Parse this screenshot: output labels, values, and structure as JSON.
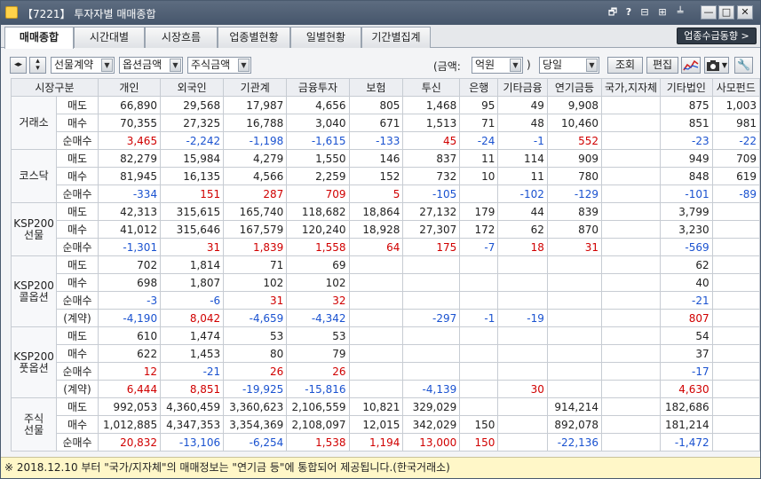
{
  "title": "【7221】 투자자별 매매종합",
  "titlebar_icons": {
    "i1": "🗗",
    "i2": "?",
    "i3": "⊟",
    "i4": "⊞",
    "i5": "╧"
  },
  "window_buttons": {
    "minimize": "—",
    "maximize": "□",
    "close": "✕"
  },
  "tabs": [
    "매매종합",
    "시간대별",
    "시장흐름",
    "업종별현황",
    "일별현황",
    "기간별집계"
  ],
  "jump_button": "업종수급동향 >",
  "toolbar": {
    "select_market": "선물계약",
    "select_option": "옵션금액",
    "select_stock": "주식금액",
    "unit_label_open": "(금액:",
    "unit_value": "억원",
    "unit_label_close": ")",
    "period_value": "당일",
    "query_button": "조회",
    "edit_button": "편집"
  },
  "columns": [
    "시장구분",
    "개인",
    "외국인",
    "기관계",
    "금융투자",
    "보험",
    "투신",
    "은행",
    "기타금융",
    "연기금등",
    "국가,지자체",
    "기타법인",
    "사모펀드"
  ],
  "sections": [
    {
      "market": "거래소",
      "rows": [
        {
          "label": "매도",
          "cells": [
            [
              "66,890",
              "k"
            ],
            [
              "29,568",
              "k"
            ],
            [
              "17,987",
              "k"
            ],
            [
              "4,656",
              "k"
            ],
            [
              "805",
              "k"
            ],
            [
              "1,468",
              "k"
            ],
            [
              "95",
              "k"
            ],
            [
              "49",
              "k"
            ],
            [
              "9,908",
              "k"
            ],
            [
              "",
              ""
            ],
            [
              "875",
              "k"
            ],
            [
              "1,003",
              "k"
            ]
          ]
        },
        {
          "label": "매수",
          "cells": [
            [
              "70,355",
              "k"
            ],
            [
              "27,325",
              "k"
            ],
            [
              "16,788",
              "k"
            ],
            [
              "3,040",
              "k"
            ],
            [
              "671",
              "k"
            ],
            [
              "1,513",
              "k"
            ],
            [
              "71",
              "k"
            ],
            [
              "48",
              "k"
            ],
            [
              "10,460",
              "k"
            ],
            [
              "",
              ""
            ],
            [
              "851",
              "k"
            ],
            [
              "981",
              "k"
            ]
          ]
        },
        {
          "label": "순매수",
          "cells": [
            [
              "3,465",
              "rb"
            ],
            [
              "-2,242",
              "bb"
            ],
            [
              "-1,198",
              "bb"
            ],
            [
              "-1,615",
              "b"
            ],
            [
              "-133",
              "b"
            ],
            [
              "45",
              "r"
            ],
            [
              "-24",
              "b"
            ],
            [
              "-1",
              "b"
            ],
            [
              "552",
              "r"
            ],
            [
              "",
              ""
            ],
            [
              "-23",
              "bb"
            ],
            [
              "-22",
              "b"
            ]
          ]
        }
      ]
    },
    {
      "market": "코스닥",
      "rows": [
        {
          "label": "매도",
          "cells": [
            [
              "82,279",
              "k"
            ],
            [
              "15,984",
              "k"
            ],
            [
              "4,279",
              "k"
            ],
            [
              "1,550",
              "k"
            ],
            [
              "146",
              "k"
            ],
            [
              "837",
              "k"
            ],
            [
              "11",
              "k"
            ],
            [
              "114",
              "k"
            ],
            [
              "909",
              "k"
            ],
            [
              "",
              ""
            ],
            [
              "949",
              "k"
            ],
            [
              "709",
              "k"
            ]
          ]
        },
        {
          "label": "매수",
          "cells": [
            [
              "81,945",
              "k"
            ],
            [
              "16,135",
              "k"
            ],
            [
              "4,566",
              "k"
            ],
            [
              "2,259",
              "k"
            ],
            [
              "152",
              "k"
            ],
            [
              "732",
              "k"
            ],
            [
              "10",
              "k"
            ],
            [
              "11",
              "k"
            ],
            [
              "780",
              "k"
            ],
            [
              "",
              ""
            ],
            [
              "848",
              "k"
            ],
            [
              "619",
              "k"
            ]
          ]
        },
        {
          "label": "순매수",
          "cells": [
            [
              "-334",
              "bb"
            ],
            [
              "151",
              "rb"
            ],
            [
              "287",
              "rb"
            ],
            [
              "709",
              "r"
            ],
            [
              "5",
              "r"
            ],
            [
              "-105",
              "b"
            ],
            [
              "",
              ""
            ],
            [
              "-102",
              "b"
            ],
            [
              "-129",
              "b"
            ],
            [
              "",
              ""
            ],
            [
              "-101",
              "bb"
            ],
            [
              "-89",
              "b"
            ]
          ]
        }
      ]
    },
    {
      "market": "KSP200\n선물",
      "rows": [
        {
          "label": "매도",
          "cells": [
            [
              "42,313",
              "k"
            ],
            [
              "315,615",
              "k"
            ],
            [
              "165,740",
              "k"
            ],
            [
              "118,682",
              "k"
            ],
            [
              "18,864",
              "k"
            ],
            [
              "27,132",
              "k"
            ],
            [
              "179",
              "k"
            ],
            [
              "44",
              "k"
            ],
            [
              "839",
              "k"
            ],
            [
              "",
              ""
            ],
            [
              "3,799",
              "k"
            ],
            [
              "",
              ""
            ]
          ]
        },
        {
          "label": "매수",
          "cells": [
            [
              "41,012",
              "k"
            ],
            [
              "315,646",
              "k"
            ],
            [
              "167,579",
              "k"
            ],
            [
              "120,240",
              "k"
            ],
            [
              "18,928",
              "k"
            ],
            [
              "27,307",
              "k"
            ],
            [
              "172",
              "k"
            ],
            [
              "62",
              "k"
            ],
            [
              "870",
              "k"
            ],
            [
              "",
              ""
            ],
            [
              "3,230",
              "k"
            ],
            [
              "",
              ""
            ]
          ]
        },
        {
          "label": "순매수",
          "cells": [
            [
              "-1,301",
              "bb"
            ],
            [
              "31",
              "rb"
            ],
            [
              "1,839",
              "rb"
            ],
            [
              "1,558",
              "r"
            ],
            [
              "64",
              "r"
            ],
            [
              "175",
              "r"
            ],
            [
              "-7",
              "b"
            ],
            [
              "18",
              "r"
            ],
            [
              "31",
              "r"
            ],
            [
              "",
              ""
            ],
            [
              "-569",
              "bb"
            ],
            [
              "",
              ""
            ]
          ]
        }
      ]
    },
    {
      "market": "KSP200\n콜옵션",
      "rows": [
        {
          "label": "매도",
          "cells": [
            [
              "702",
              "k"
            ],
            [
              "1,814",
              "k"
            ],
            [
              "71",
              "k"
            ],
            [
              "69",
              "k"
            ],
            [
              "",
              ""
            ],
            [
              "",
              ""
            ],
            [
              "",
              ""
            ],
            [
              "",
              ""
            ],
            [
              "",
              ""
            ],
            [
              "",
              ""
            ],
            [
              "62",
              "k"
            ],
            [
              "",
              ""
            ]
          ]
        },
        {
          "label": "매수",
          "cells": [
            [
              "698",
              "k"
            ],
            [
              "1,807",
              "k"
            ],
            [
              "102",
              "k"
            ],
            [
              "102",
              "k"
            ],
            [
              "",
              ""
            ],
            [
              "",
              ""
            ],
            [
              "",
              ""
            ],
            [
              "",
              ""
            ],
            [
              "",
              ""
            ],
            [
              "",
              ""
            ],
            [
              "40",
              "k"
            ],
            [
              "",
              ""
            ]
          ]
        },
        {
          "label": "순매수",
          "cells": [
            [
              "-3",
              "bb"
            ],
            [
              "-6",
              "bb"
            ],
            [
              "31",
              "rb"
            ],
            [
              "32",
              "r"
            ],
            [
              "",
              ""
            ],
            [
              "",
              ""
            ],
            [
              "",
              ""
            ],
            [
              "",
              ""
            ],
            [
              "",
              ""
            ],
            [
              "",
              ""
            ],
            [
              "-21",
              "bb"
            ],
            [
              "",
              ""
            ]
          ]
        },
        {
          "label": "(계약)",
          "cells": [
            [
              "-4,190",
              "b"
            ],
            [
              "8,042",
              "r"
            ],
            [
              "-4,659",
              "b"
            ],
            [
              "-4,342",
              "b"
            ],
            [
              "",
              ""
            ],
            [
              "-297",
              "b"
            ],
            [
              "-1",
              "b"
            ],
            [
              "-19",
              "b"
            ],
            [
              "",
              ""
            ],
            [
              "",
              ""
            ],
            [
              "807",
              "r"
            ],
            [
              "",
              ""
            ]
          ]
        }
      ]
    },
    {
      "market": "KSP200\n풋옵션",
      "rows": [
        {
          "label": "매도",
          "cells": [
            [
              "610",
              "k"
            ],
            [
              "1,474",
              "k"
            ],
            [
              "53",
              "k"
            ],
            [
              "53",
              "k"
            ],
            [
              "",
              ""
            ],
            [
              "",
              ""
            ],
            [
              "",
              ""
            ],
            [
              "",
              ""
            ],
            [
              "",
              ""
            ],
            [
              "",
              ""
            ],
            [
              "54",
              "k"
            ],
            [
              "",
              ""
            ]
          ]
        },
        {
          "label": "매수",
          "cells": [
            [
              "622",
              "k"
            ],
            [
              "1,453",
              "k"
            ],
            [
              "80",
              "k"
            ],
            [
              "79",
              "k"
            ],
            [
              "",
              ""
            ],
            [
              "",
              ""
            ],
            [
              "",
              ""
            ],
            [
              "",
              ""
            ],
            [
              "",
              ""
            ],
            [
              "",
              ""
            ],
            [
              "37",
              "k"
            ],
            [
              "",
              ""
            ]
          ]
        },
        {
          "label": "순매수",
          "cells": [
            [
              "12",
              "rb"
            ],
            [
              "-21",
              "bb"
            ],
            [
              "26",
              "rb"
            ],
            [
              "26",
              "r"
            ],
            [
              "",
              ""
            ],
            [
              "",
              ""
            ],
            [
              "",
              ""
            ],
            [
              "",
              ""
            ],
            [
              "",
              ""
            ],
            [
              "",
              ""
            ],
            [
              "-17",
              "bb"
            ],
            [
              "",
              ""
            ]
          ]
        },
        {
          "label": "(계약)",
          "cells": [
            [
              "6,444",
              "r"
            ],
            [
              "8,851",
              "r"
            ],
            [
              "-19,925",
              "b"
            ],
            [
              "-15,816",
              "b"
            ],
            [
              "",
              ""
            ],
            [
              "-4,139",
              "b"
            ],
            [
              "",
              ""
            ],
            [
              "30",
              "r"
            ],
            [
              "",
              ""
            ],
            [
              "",
              ""
            ],
            [
              "4,630",
              "r"
            ],
            [
              "",
              ""
            ]
          ]
        }
      ]
    },
    {
      "market": "주식\n선물",
      "rows": [
        {
          "label": "매도",
          "cells": [
            [
              "992,053",
              "k"
            ],
            [
              "4,360,459",
              "k"
            ],
            [
              "3,360,623",
              "k"
            ],
            [
              "2,106,559",
              "k"
            ],
            [
              "10,821",
              "k"
            ],
            [
              "329,029",
              "k"
            ],
            [
              "",
              ""
            ],
            [
              "",
              ""
            ],
            [
              "914,214",
              "k"
            ],
            [
              "",
              ""
            ],
            [
              "182,686",
              "k"
            ],
            [
              "",
              ""
            ]
          ]
        },
        {
          "label": "매수",
          "cells": [
            [
              "1,012,885",
              "k"
            ],
            [
              "4,347,353",
              "k"
            ],
            [
              "3,354,369",
              "k"
            ],
            [
              "2,108,097",
              "k"
            ],
            [
              "12,015",
              "k"
            ],
            [
              "342,029",
              "k"
            ],
            [
              "150",
              "k"
            ],
            [
              "",
              ""
            ],
            [
              "892,078",
              "k"
            ],
            [
              "",
              ""
            ],
            [
              "181,214",
              "k"
            ],
            [
              "",
              ""
            ]
          ]
        },
        {
          "label": "순매수",
          "cells": [
            [
              "20,832",
              "rb"
            ],
            [
              "-13,106",
              "bb"
            ],
            [
              "-6,254",
              "bb"
            ],
            [
              "1,538",
              "r"
            ],
            [
              "1,194",
              "r"
            ],
            [
              "13,000",
              "r"
            ],
            [
              "150",
              "r"
            ],
            [
              "",
              ""
            ],
            [
              "-22,136",
              "b"
            ],
            [
              "",
              ""
            ],
            [
              "-1,472",
              "bb"
            ],
            [
              "",
              ""
            ]
          ]
        }
      ]
    }
  ],
  "status": "※ 2018.12.10 부터 \"국가/지자체\"의 매매정보는 \"연기금 등\"에 통합되어 제공됩니다.(한국거래소)"
}
